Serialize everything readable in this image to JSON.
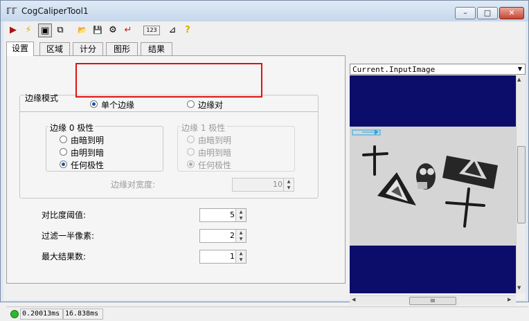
{
  "window": {
    "title": "CogCaliperTool1",
    "logo": "ℾℾ"
  },
  "toolbar": {
    "items": [
      {
        "icon": "run-icon",
        "glyph": "▶"
      },
      {
        "icon": "electric-icon",
        "glyph": "⚡"
      },
      {
        "icon": "image-view-icon",
        "glyph": "▣"
      },
      {
        "icon": "toggle-panel-icon",
        "glyph": "⧉"
      },
      {
        "icon": "open-icon",
        "glyph": "📂"
      },
      {
        "icon": "save-icon",
        "glyph": "💾"
      },
      {
        "icon": "settings-icon",
        "glyph": "⚙"
      },
      {
        "icon": "reset-icon",
        "glyph": "↵"
      },
      {
        "icon": "counter-icon",
        "glyph": "123"
      },
      {
        "icon": "measure-icon",
        "glyph": "⊿"
      },
      {
        "icon": "help-icon",
        "glyph": "?"
      }
    ]
  },
  "tabs": [
    "设置",
    "区域",
    "计分",
    "图形",
    "结果"
  ],
  "edge_mode": {
    "label": "边缘模式",
    "options": [
      {
        "label": "单个边缘",
        "selected": true
      },
      {
        "label": "边缘对",
        "selected": false
      }
    ]
  },
  "edge0": {
    "title": "边缘 0 极性",
    "options": [
      {
        "label": "由暗到明",
        "selected": false
      },
      {
        "label": "由明到暗",
        "selected": false
      },
      {
        "label": "任何极性",
        "selected": true
      }
    ]
  },
  "edge1": {
    "title": "边缘 1 极性",
    "options": [
      {
        "label": "由暗到明",
        "selected": false
      },
      {
        "label": "由明到暗",
        "selected": false
      },
      {
        "label": "任何极性",
        "selected": true
      }
    ]
  },
  "pair_width": {
    "label": "边缘对宽度:",
    "value": "10"
  },
  "params": [
    {
      "label": "对比度阈值:",
      "value": "5"
    },
    {
      "label": "过滤一半像素:",
      "value": "2"
    },
    {
      "label": "最大结果数:",
      "value": "1"
    }
  ],
  "image": {
    "dropdown": "Current.InputImage",
    "scroll_label": "III"
  },
  "status": {
    "time1": "0.20013ms",
    "time2": "16.838ms",
    "indicator_color": "#2db82d"
  },
  "colors": {
    "highlight": "#e01010",
    "display_bg": "#0c0d6b",
    "roi": "#23a6e8"
  }
}
